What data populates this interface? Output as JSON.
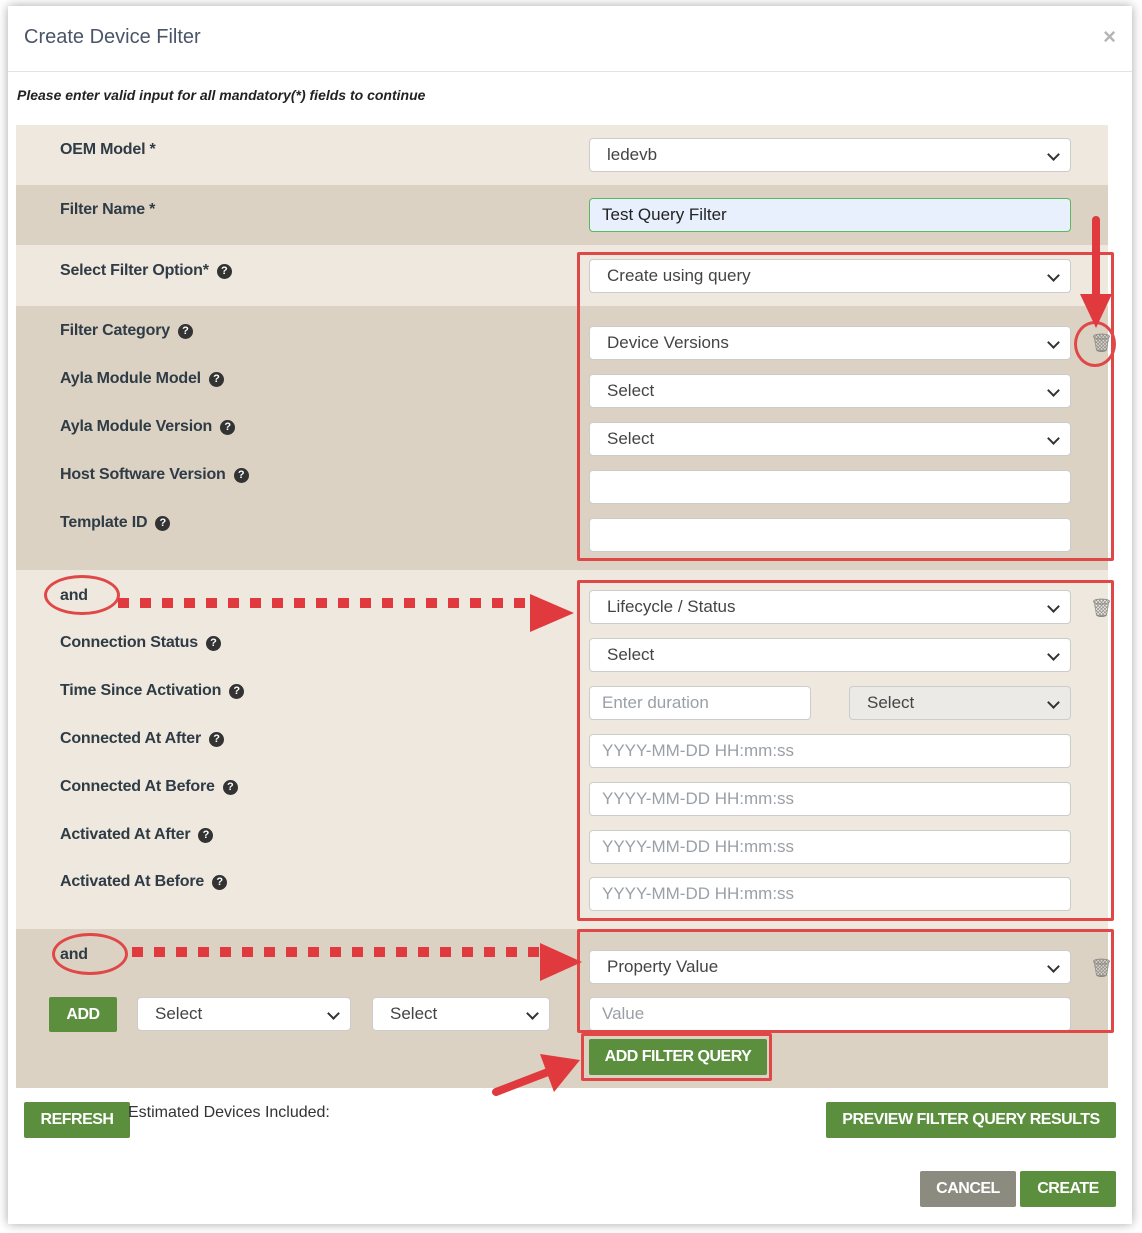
{
  "dialog": {
    "title": "Create Device Filter",
    "close": "×",
    "instructions": "Please enter valid input for all mandatory(*) fields to continue"
  },
  "oem_model": {
    "label": "OEM Model *",
    "value": "ledevb"
  },
  "filter_name": {
    "label": "Filter Name *",
    "value": "Test Query Filter"
  },
  "filter_option": {
    "label": "Select Filter Option*",
    "value": "Create using query"
  },
  "group1": {
    "category_label": "Filter Category",
    "category_value": "Device Versions",
    "fields": [
      {
        "label": "Ayla Module Model",
        "value": "Select"
      },
      {
        "label": "Ayla Module Version",
        "value": "Select"
      },
      {
        "label": "Host Software Version",
        "value": ""
      },
      {
        "label": "Template ID",
        "value": ""
      }
    ]
  },
  "group2": {
    "conjunction": "and",
    "category_value": "Lifecycle / Status",
    "connection_status": {
      "label": "Connection Status",
      "value": "Select"
    },
    "time_since_activation": {
      "label": "Time Since Activation",
      "placeholder": "Enter duration",
      "unit": "Select"
    },
    "date_fields": [
      {
        "label": "Connected At After",
        "placeholder": "YYYY-MM-DD HH:mm:ss"
      },
      {
        "label": "Connected At Before",
        "placeholder": "YYYY-MM-DD HH:mm:ss"
      },
      {
        "label": "Activated At After",
        "placeholder": "YYYY-MM-DD HH:mm:ss"
      },
      {
        "label": "Activated At Before",
        "placeholder": "YYYY-MM-DD HH:mm:ss"
      }
    ]
  },
  "group3": {
    "conjunction": "and",
    "category_value": "Property Value",
    "add_label": "ADD",
    "select1": "Select",
    "select2": "Select",
    "value_placeholder": "Value"
  },
  "actions": {
    "add_filter_query": "ADD FILTER QUERY",
    "refresh": "REFRESH",
    "estimated": "Estimated Devices Included:",
    "preview": "PREVIEW FILTER QUERY RESULTS",
    "cancel": "CANCEL",
    "create": "CREATE"
  },
  "colors": {
    "accent_green": "#5b8f3e",
    "annotation_red": "#e04848",
    "band_light": "#efe8de",
    "band_dark": "#dbd2c3"
  }
}
